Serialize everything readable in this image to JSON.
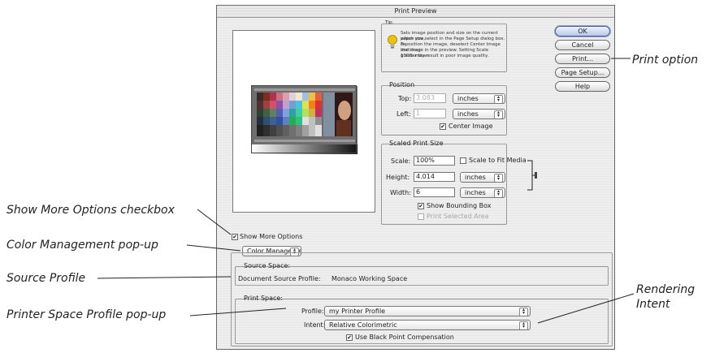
{
  "dialog": {
    "title": "Print Preview"
  },
  "tip": {
    "heading": "Tip:",
    "lines": [
      "Sets image position and size on the current paper size,",
      "which you select in the Page Setup dialog box. To",
      "reposition the image, deselect Center Image and drag",
      "the image in the preview. Setting Scale greater than",
      "100% may result in poor image quality."
    ]
  },
  "buttons": {
    "ok": "OK",
    "cancel": "Cancel",
    "print": "Print...",
    "page_setup": "Page Setup...",
    "help": "Help"
  },
  "position": {
    "title": "Position",
    "top_label": "Top:",
    "top_value": "3.083",
    "top_unit": "inches",
    "left_label": "Left:",
    "left_value": "1",
    "left_unit": "inches",
    "center_image": "Center Image"
  },
  "scaled": {
    "title": "Scaled Print Size",
    "scale_label": "Scale:",
    "scale_value": "100%",
    "scale_to_fit": "Scale to Fit Media",
    "height_label": "Height:",
    "height_value": "4.014",
    "height_unit": "inches",
    "width_label": "Width:",
    "width_value": "6",
    "width_unit": "inches",
    "show_bounding_box": "Show Bounding Box",
    "print_selected_area": "Print Selected Area"
  },
  "show_more_options": "Show More Options",
  "color_management_popup": "Color Management",
  "source_space": {
    "title": "Source Space:",
    "label": "Document Source Profile:",
    "value": "Monaco Working Space"
  },
  "print_space": {
    "title": "Print Space:",
    "profile_label": "Profile:",
    "profile_value": "my Printer Profile",
    "intent_label": "Intent:",
    "intent_value": "Relative Colorimetric",
    "black_point": "Use Black Point Compensation"
  },
  "callouts": {
    "print_option": "Print option",
    "show_more_options": "Show More Options checkbox",
    "color_management": "Color Management pop-up",
    "source_profile": "Source Profile",
    "printer_space": "Printer Space Profile pop-up",
    "rendering_intent_1": "Rendering",
    "rendering_intent_2": "Intent"
  },
  "icons": {
    "tip": "lightbulb-icon",
    "link": "chain-link-icon",
    "popup_arrows": "up-down-arrows-icon",
    "check": "checkmark-icon"
  },
  "colors": {
    "default_button": "#b9c8e8",
    "tip_bulb": "#f2c200"
  }
}
